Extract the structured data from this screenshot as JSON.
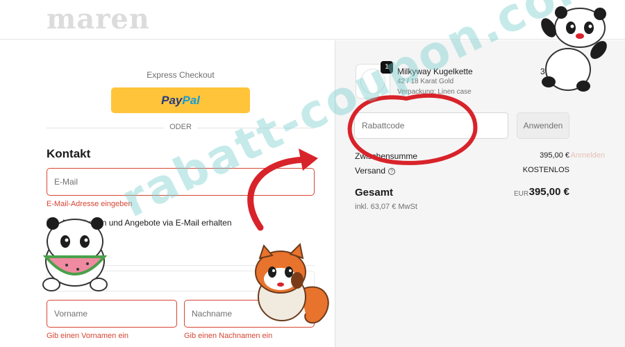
{
  "brand": {
    "logo_text": "maren"
  },
  "express": {
    "label": "Express Checkout",
    "paypal_pay": "Pay",
    "paypal_pal": "Pal",
    "divider": "ODER"
  },
  "contact": {
    "heading": "Kontakt",
    "login_link": "Anmelden",
    "email_placeholder": "E-Mail",
    "email_error": "E-Mail-Adresse eingeben",
    "newsletter_label": "Neuigkeiten und Angebote via E-Mail erhalten"
  },
  "delivery": {
    "first_name_placeholder": "Vorname",
    "last_name_placeholder": "Nachname",
    "first_name_error": "Gib einen Vornamen ein",
    "last_name_error": "Gib einen Nachnamen ein"
  },
  "order": {
    "item": {
      "quantity": "1",
      "name": "Milkyway Kugelkette",
      "variant": "42 / 18 Karat Gold",
      "packaging": "Verpackung: Linen case",
      "price": "395,00 €"
    },
    "discount_placeholder": "Rabattcode",
    "apply_label": "Anwenden",
    "subtotal_label": "Zwischensumme",
    "subtotal_value": "395,00 €",
    "shipping_label": "Versand",
    "shipping_value": "KOSTENLOS",
    "total_label": "Gesamt",
    "total_currency": "EUR",
    "total_value": "395,00 €",
    "tax_note": "inkl. 63,07 € MwSt"
  },
  "overlay": {
    "watermark": "rabatt-coupon.com",
    "arrow_color": "#d8232a",
    "circle_color": "#d8232a",
    "stickers": [
      "panda-sticker",
      "red-panda-sticker",
      "panda-watermelon-sticker"
    ]
  }
}
